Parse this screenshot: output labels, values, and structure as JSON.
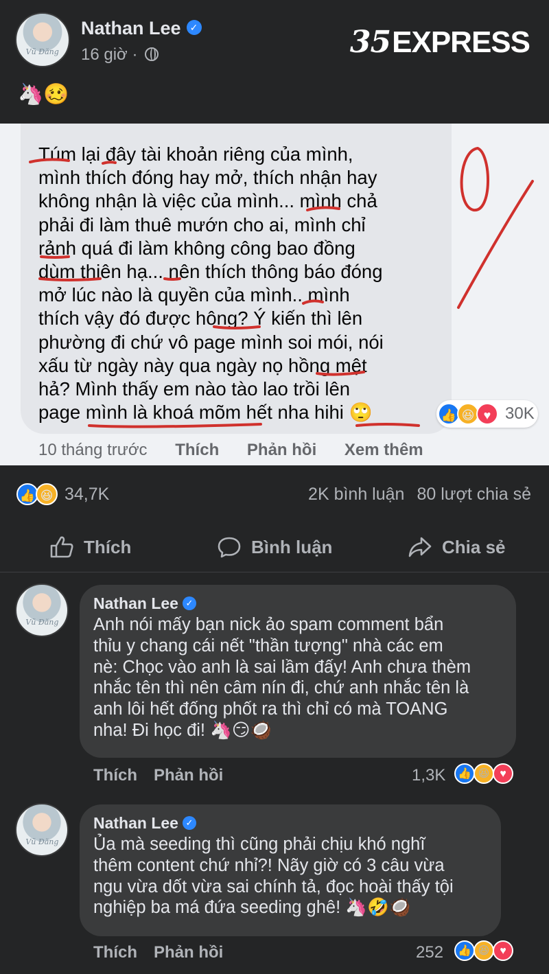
{
  "post": {
    "author": "Nathan Lee",
    "time": "16 giờ ·",
    "emoji": "🦄🥴",
    "watermark_mark": "35",
    "watermark_text": "EXPRESS",
    "avatar_signature": "Vũ Đăng"
  },
  "screenshot": {
    "quote_lines": [
      "Túm lại đây tài khoản riêng của mình,",
      "mình thích đóng hay mở, thích nhận hay",
      "không nhận là việc của mình... mình chả",
      "phải đi làm thuê mướn cho ai, mình chỉ",
      "rảnh quá đi làm không công bao đồng",
      "dùm thiên hạ... nên thích thông báo đóng",
      "mở lúc nào là quyền của mình.. mình",
      "thích vậy đó được hông? Ý kiến thì lên",
      "phường đi chứ vô page mình soi mói, nói",
      "xấu từ ngày này qua ngày nọ hồng mệt",
      "hả? Mình thấy em nào tào lao trồi lên",
      "page mình là khoá mõm hết nha hihi 🙄"
    ],
    "reaction_count": "30K",
    "actions": {
      "time": "10 tháng trước",
      "like": "Thích",
      "reply": "Phản hồi",
      "more": "Xem thêm"
    },
    "annotation_color": "#d0312d"
  },
  "stats": {
    "reactions": "34,7K",
    "comments": "2K bình luận",
    "shares": "80 lượt chia sẻ"
  },
  "action_bar": {
    "like": "Thích",
    "comment": "Bình luận",
    "share": "Chia sẻ"
  },
  "comments": [
    {
      "author": "Nathan Lee",
      "lines": [
        "Anh nói mấy bạn nick ảo spam comment bẩn",
        "thỉu y chang cái nết \"thần tượng\" nhà các em",
        "nè: Chọc vào anh là sai lầm đấy! Anh chưa thèm",
        "nhắc tên thì nên câm nín đi, chứ anh nhắc tên là",
        "anh lôi hết đống phốt ra thì chỉ có mà TOANG",
        "nha! Đi học đi! 🦄😏🥥"
      ],
      "like": "Thích",
      "reply": "Phản hồi",
      "reaction_count": "1,3K"
    },
    {
      "author": "Nathan Lee",
      "lines": [
        "Ủa mà seeding thì cũng phải chịu khó nghĩ",
        "thêm content chứ nhỉ?! Nãy giờ có 3 câu vừa",
        "ngu vừa dốt vừa sai chính tả, đọc hoài thấy tội",
        "nghiệp ba má đứa seeding ghê! 🦄🤣🥥"
      ],
      "like": "Thích",
      "reply": "Phản hồi",
      "reaction_count": "252"
    }
  ],
  "colors": {
    "background": "#242526",
    "bubble": "#3a3b3c",
    "text": "#e4e6eb",
    "muted": "#b0b3b8",
    "accent": "#2d88ff"
  },
  "icons": [
    "globe-icon",
    "verified-icon",
    "like-icon",
    "comment-icon",
    "share-icon",
    "like-reaction-icon",
    "haha-reaction-icon",
    "love-reaction-icon"
  ]
}
